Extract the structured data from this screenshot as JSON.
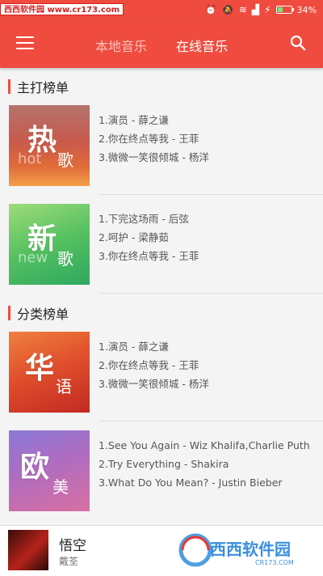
{
  "status": {
    "watermark": "西西软件园 www.cr173.com",
    "battery": "34%",
    "battery_level": 0.34
  },
  "appbar": {
    "tabs": [
      {
        "label": "本地音乐",
        "active": false
      },
      {
        "label": "在线音乐",
        "active": true
      }
    ]
  },
  "sections": [
    {
      "title": "主打榜单",
      "lists": [
        {
          "cover_main": "热",
          "cover_sub": "歌",
          "cover_eng": "hot",
          "songs": [
            "1.演员 - 薛之谦",
            "2.你在终点等我 - 王菲",
            "3.微微一笑很倾城 - 杨洋"
          ]
        },
        {
          "cover_main": "新",
          "cover_sub": "歌",
          "cover_eng": "new",
          "songs": [
            "1.下完这场雨 - 后弦",
            "2.呵护 - 梁静茹",
            "3.你在终点等我 - 王菲"
          ]
        }
      ]
    },
    {
      "title": "分类榜单",
      "lists": [
        {
          "cover_main": "华",
          "cover_sub": "语",
          "cover_eng": "",
          "songs": [
            "1.演员 - 薛之谦",
            "2.你在终点等我 - 王菲",
            "3.微微一笑很倾城 - 杨洋"
          ]
        },
        {
          "cover_main": "欧",
          "cover_sub": "美",
          "cover_eng": "",
          "songs": [
            "1.See You Again - Wiz Khalifa,Charlie Puth",
            "2.Try Everything - Shakira",
            "3.What Do You Mean? - Justin Bieber"
          ]
        }
      ]
    }
  ],
  "player": {
    "title": "悟空",
    "artist": "戴荃"
  },
  "footer_watermark": {
    "brand": "西西软件园",
    "url": "CR173.COM"
  },
  "colors": {
    "accent": "#ef4c3f"
  }
}
